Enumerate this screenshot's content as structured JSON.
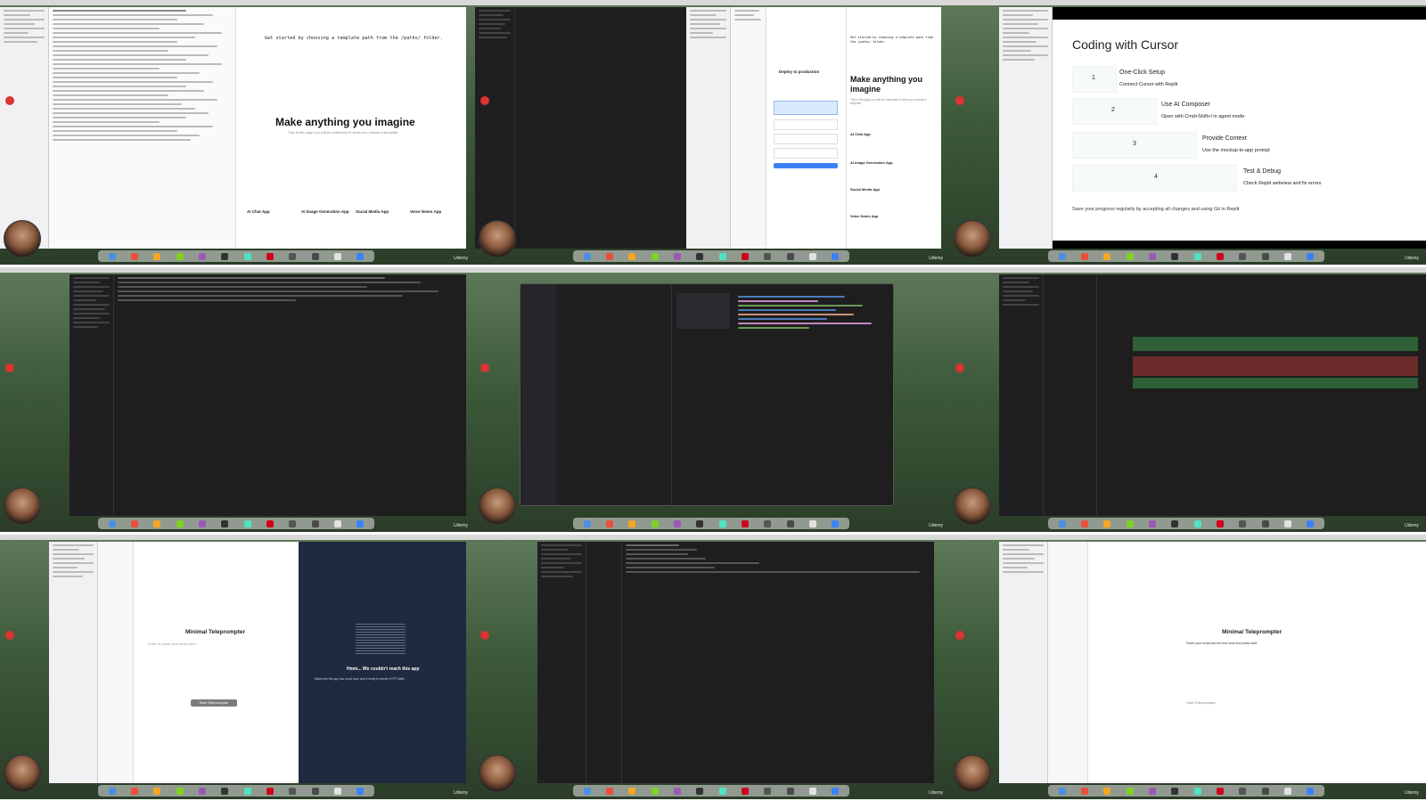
{
  "main": {
    "t1": {
      "header_text": "Get started by choosing a template path from the /paths/ folder.",
      "hero_title": "Make anything you imagine",
      "hero_sub": "This is the page you will be redirected to when you choose a template",
      "cards": [
        "AI Chat App",
        "AI Image Generation App",
        "Social Media App",
        "Voice Notes App"
      ]
    },
    "t3": {
      "header_text": "Get started by choosing a template path from the /paths/ folder.",
      "hero_title": "Make anything you imagine",
      "hero_sub": "This is the page you will be redirected to when you choose a template",
      "modal_title": "Deploy to production",
      "sections": [
        "AI Chat App",
        "AI Image Generation App",
        "Social Media App",
        "Voice Notes App"
      ]
    },
    "t4": {
      "title": "Coding with Cursor",
      "steps": [
        {
          "n": "1",
          "title": "One-Click Setup",
          "desc": "Connect Cursor with Replit"
        },
        {
          "n": "2",
          "title": "Use AI Composer",
          "desc": "Open with Cmd+Shift+I in agent mode"
        },
        {
          "n": "3",
          "title": "Provide Context",
          "desc": "Use the mockup-to-app prompt"
        },
        {
          "n": "4",
          "title": "Test & Debug",
          "desc": "Check Replit webview and fix errors"
        }
      ],
      "footer": "Save your progress regularly by accepting all changes and using Git in Replit"
    },
    "t7": {
      "app_title": "Minimal Teleprompter",
      "placeholder": "Enter or paste your script here...",
      "button": "Start Teleprompter",
      "error_title": "Hmm... We couldn't reach this app",
      "error_sub": "Make sure this app has a port open and is ready to receive HTTP traffic."
    },
    "t9": {
      "app_title": "Minimal Teleprompter",
      "body": "Paste your script into the text area and press start.",
      "button": "Start Teleprompter"
    },
    "watermark": "Udemy"
  },
  "colors": {
    "dark_bg": "#1e1e1e",
    "light_bg": "#ffffff",
    "accent_green": "#2e7d32",
    "accent_blue": "#3b82f6",
    "error_panel": "#1f2a40"
  }
}
